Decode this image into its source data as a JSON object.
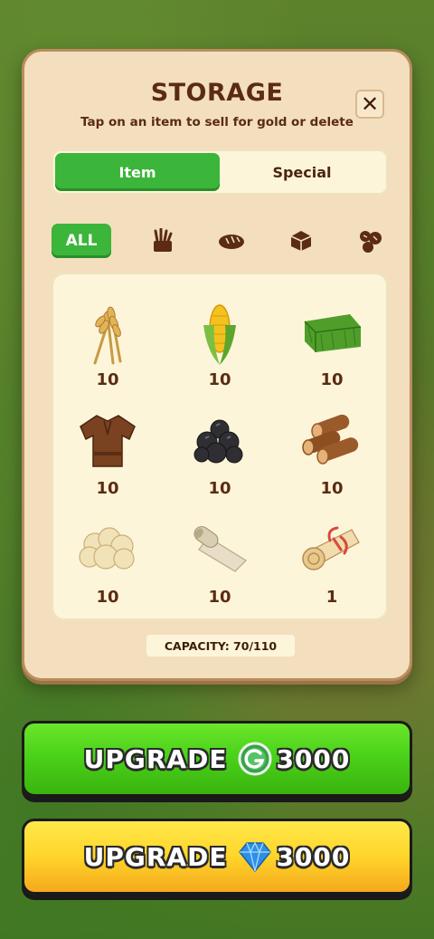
{
  "panel": {
    "title": "STORAGE",
    "subtitle": "Tap on an item to sell for gold or delete",
    "close_label": "✕"
  },
  "tabs": [
    {
      "label": "Item",
      "active": true
    },
    {
      "label": "Special",
      "active": false
    }
  ],
  "filters": {
    "all_label": "ALL",
    "icons": [
      "crop-filter-icon",
      "bakery-filter-icon",
      "product-filter-icon",
      "material-filter-icon"
    ]
  },
  "items": [
    {
      "icon": "wheat-icon",
      "qty": "10"
    },
    {
      "icon": "corn-icon",
      "qty": "10"
    },
    {
      "icon": "hay-bale-icon",
      "qty": "10"
    },
    {
      "icon": "shirt-icon",
      "qty": "10"
    },
    {
      "icon": "coal-icon",
      "qty": "10"
    },
    {
      "icon": "wood-logs-icon",
      "qty": "10"
    },
    {
      "icon": "wool-icon",
      "qty": "10"
    },
    {
      "icon": "cloth-roll-icon",
      "qty": "10"
    },
    {
      "icon": "scroll-icon",
      "qty": "1"
    }
  ],
  "capacity": "CAPACITY: 70/110",
  "buttons": {
    "gold": {
      "label": "UPGRADE",
      "price": "3000",
      "icon": "gold-coin-icon"
    },
    "gem": {
      "label": "UPGRADE",
      "price": "3000",
      "icon": "gem-icon"
    }
  },
  "colors": {
    "accent_green": "#3bb53a",
    "panel": "#f3dfbd",
    "text_brown": "#5b2b12"
  }
}
